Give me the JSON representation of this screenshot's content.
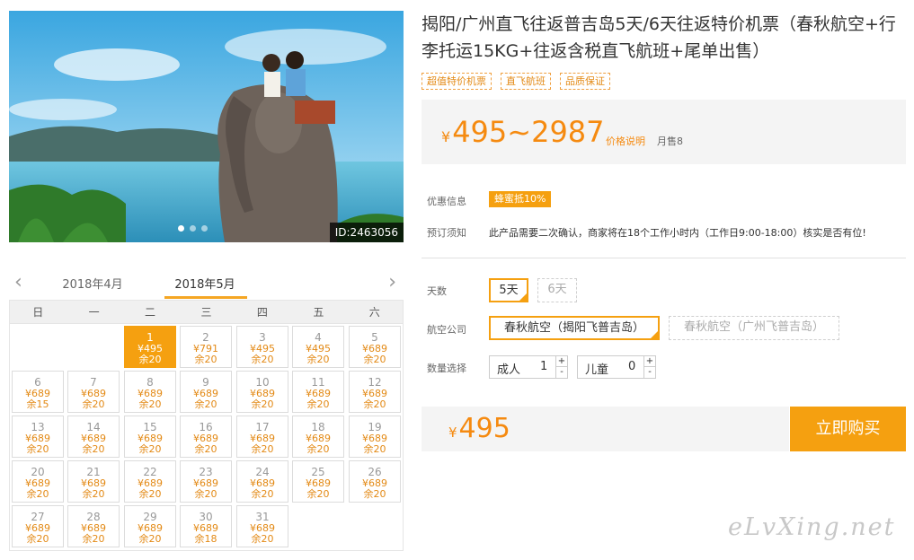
{
  "product": {
    "title": "揭阳/广州直飞往返普吉岛5天/6天往返特价机票（春秋航空+行李托运15KG+往返含税直飞航班+尾单出售）",
    "tags": [
      "超值特价机票",
      "直飞航班",
      "品质保证"
    ],
    "image_id": "ID:2463056"
  },
  "price": {
    "currency": "¥",
    "range": "495~2987",
    "note": "价格说明",
    "sold": "月售8"
  },
  "offers": {
    "label": "优惠信息",
    "badge": "蜂蜜抵10%"
  },
  "booking_notice": {
    "label": "预订须知",
    "text": "此产品需要二次确认，商家将在18个工作小时内（工作日9:00-18:00）核实是否有位!"
  },
  "options": {
    "days_label": "天数",
    "days": [
      {
        "label": "5天",
        "selected": true
      },
      {
        "label": "6天",
        "selected": false
      }
    ],
    "airline_label": "航空公司",
    "airlines": [
      {
        "label": "春秋航空（揭阳飞普吉岛）",
        "selected": true
      },
      {
        "label": "春秋航空（广州飞普吉岛）",
        "selected": false
      }
    ],
    "qty_label": "数量选择",
    "adult_label": "成人",
    "adult_count": "1",
    "child_label": "儿童",
    "child_count": "0",
    "plus": "+",
    "minus": "-"
  },
  "purchase": {
    "price": "495",
    "buy_label": "立即购买"
  },
  "calendar": {
    "prev_month": "2018年4月",
    "current_month": "2018年5月",
    "weekdays": [
      "日",
      "一",
      "二",
      "三",
      "四",
      "五",
      "六"
    ],
    "first_weekday": 2,
    "selected_day": 1,
    "days": [
      {
        "day": "1",
        "price": "¥495",
        "stock": "余20"
      },
      {
        "day": "2",
        "price": "¥791",
        "stock": "余20"
      },
      {
        "day": "3",
        "price": "¥495",
        "stock": "余20"
      },
      {
        "day": "4",
        "price": "¥495",
        "stock": "余20"
      },
      {
        "day": "5",
        "price": "¥689",
        "stock": "余20"
      },
      {
        "day": "6",
        "price": "¥689",
        "stock": "余15"
      },
      {
        "day": "7",
        "price": "¥689",
        "stock": "余20"
      },
      {
        "day": "8",
        "price": "¥689",
        "stock": "余20"
      },
      {
        "day": "9",
        "price": "¥689",
        "stock": "余20"
      },
      {
        "day": "10",
        "price": "¥689",
        "stock": "余20"
      },
      {
        "day": "11",
        "price": "¥689",
        "stock": "余20"
      },
      {
        "day": "12",
        "price": "¥689",
        "stock": "余20"
      },
      {
        "day": "13",
        "price": "¥689",
        "stock": "余20"
      },
      {
        "day": "14",
        "price": "¥689",
        "stock": "余20"
      },
      {
        "day": "15",
        "price": "¥689",
        "stock": "余20"
      },
      {
        "day": "16",
        "price": "¥689",
        "stock": "余20"
      },
      {
        "day": "17",
        "price": "¥689",
        "stock": "余20"
      },
      {
        "day": "18",
        "price": "¥689",
        "stock": "余20"
      },
      {
        "day": "19",
        "price": "¥689",
        "stock": "余20"
      },
      {
        "day": "20",
        "price": "¥689",
        "stock": "余20"
      },
      {
        "day": "21",
        "price": "¥689",
        "stock": "余20"
      },
      {
        "day": "22",
        "price": "¥689",
        "stock": "余20"
      },
      {
        "day": "23",
        "price": "¥689",
        "stock": "余20"
      },
      {
        "day": "24",
        "price": "¥689",
        "stock": "余20"
      },
      {
        "day": "25",
        "price": "¥689",
        "stock": "余20"
      },
      {
        "day": "26",
        "price": "¥689",
        "stock": "余20"
      },
      {
        "day": "27",
        "price": "¥689",
        "stock": "余20"
      },
      {
        "day": "28",
        "price": "¥689",
        "stock": "余20"
      },
      {
        "day": "29",
        "price": "¥689",
        "stock": "余20"
      },
      {
        "day": "30",
        "price": "¥689",
        "stock": "余18"
      },
      {
        "day": "31",
        "price": "¥689",
        "stock": "余20"
      }
    ]
  },
  "watermark": "eLvXing.net"
}
